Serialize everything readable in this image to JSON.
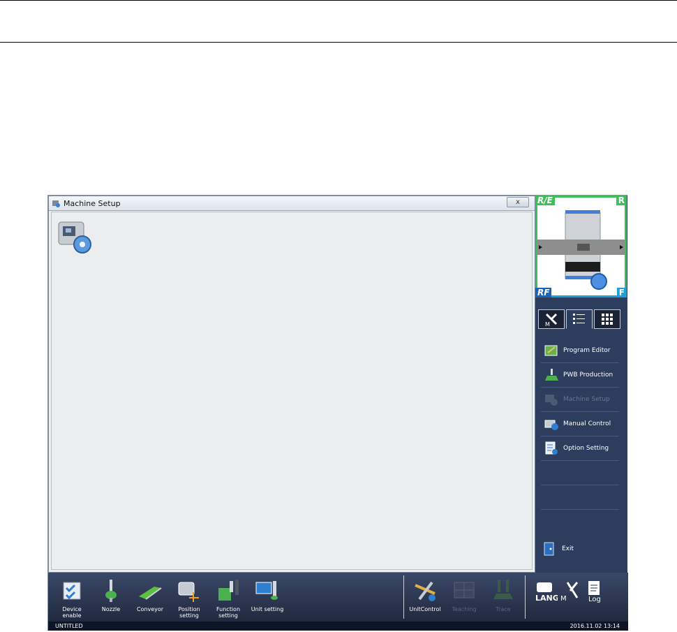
{
  "window": {
    "title": "Machine Setup",
    "close_label": "x"
  },
  "minimap": {
    "corners": {
      "top_left": "R/E",
      "top_right": "R",
      "bottom_left": "RF",
      "bottom_right": "F"
    }
  },
  "side_tabs": [
    {
      "icon": "maintenance-icon",
      "active": false
    },
    {
      "icon": "list-icon",
      "active": true
    },
    {
      "icon": "grid-icon",
      "active": false
    }
  ],
  "side_menu": [
    {
      "label": "Program Editor",
      "icon": "program-editor-icon",
      "enabled": true
    },
    {
      "label": "PWB Production",
      "icon": "pwb-production-icon",
      "enabled": true
    },
    {
      "label": "Machine Setup",
      "icon": "machine-setup-icon",
      "enabled": false
    },
    {
      "label": "Manual Control",
      "icon": "manual-control-icon",
      "enabled": true
    },
    {
      "label": "Option Setting",
      "icon": "option-setting-icon",
      "enabled": true
    },
    {
      "label": "",
      "enabled": false
    },
    {
      "label": "",
      "enabled": false
    }
  ],
  "exit_label": "Exit",
  "toolbar": {
    "left": [
      {
        "label": "Device enable",
        "icon": "device-enable-icon"
      },
      {
        "label": "Nozzle",
        "icon": "nozzle-icon"
      },
      {
        "label": "Conveyor",
        "icon": "conveyor-icon"
      },
      {
        "label": "Position setting",
        "icon": "position-setting-icon"
      },
      {
        "label": "Function setting",
        "icon": "function-setting-icon"
      },
      {
        "label": "Unit setting",
        "icon": "unit-setting-icon"
      }
    ],
    "right": [
      {
        "label": "UnitControl",
        "icon": "unit-control-icon",
        "enabled": true
      },
      {
        "label": "Teaching",
        "icon": "teaching-icon",
        "enabled": false
      },
      {
        "label": "Trace",
        "icon": "trace-icon",
        "enabled": false
      }
    ],
    "system": [
      {
        "label": "LANG",
        "icon": "language-icon"
      },
      {
        "label": "M",
        "icon": "maintenance-icon"
      },
      {
        "label": "Log",
        "icon": "log-icon"
      }
    ]
  },
  "status": {
    "file": "UNTITLED",
    "datetime": "2016.11.02 13:14"
  },
  "colors": {
    "panel": "#2d3d5e",
    "minimap_top": "#3dbf5a",
    "minimap_bottom": "#1e9fd8"
  }
}
